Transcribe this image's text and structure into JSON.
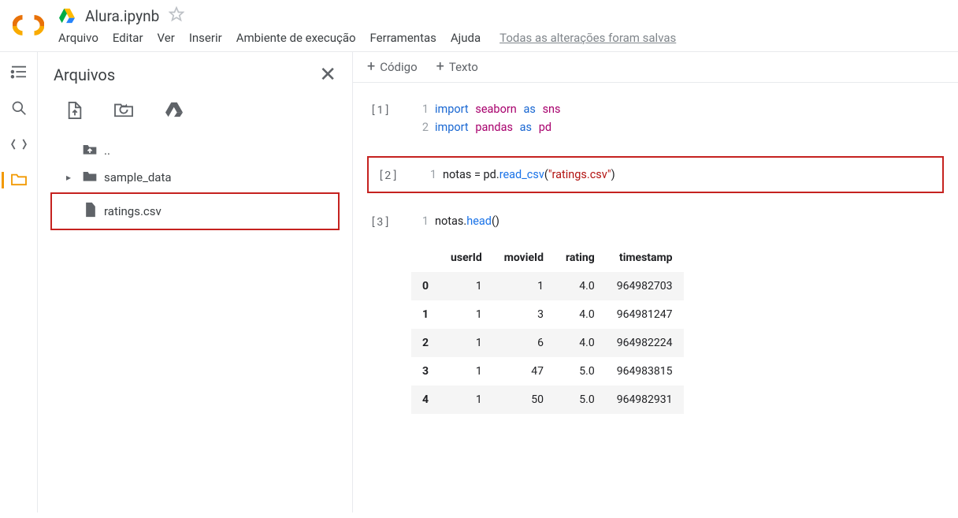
{
  "header": {
    "notebook_title": "Alura.ipynb",
    "menu": [
      "Arquivo",
      "Editar",
      "Ver",
      "Inserir",
      "Ambiente de execução",
      "Ferramentas",
      "Ajuda"
    ],
    "save_status": "Todas as alterações foram salvas"
  },
  "rail": {
    "toc_icon": "toc-icon",
    "search_icon": "search-icon",
    "vars_icon": "vars-icon",
    "folder_icon": "folder-icon"
  },
  "sidebar": {
    "title": "Arquivos",
    "tools": [
      "upload-icon",
      "refresh-icon",
      "mount-drive-icon"
    ],
    "tree": {
      "up": "..",
      "sample_data": "sample_data",
      "ratings": "ratings.csv"
    }
  },
  "content_toolbar": {
    "code": "Código",
    "text": "Texto"
  },
  "cells": {
    "c1_prompt": "[1]",
    "c1_line1_gutter": "1",
    "c1_line1_a": "import",
    "c1_line1_b": "seaborn",
    "c1_line1_c": "as",
    "c1_line1_d": "sns",
    "c1_line2_gutter": "2",
    "c1_line2_a": "import",
    "c1_line2_b": "pandas",
    "c1_line2_c": "as",
    "c1_line2_d": "pd",
    "c2_prompt": "[2]",
    "c2_line1_gutter": "1",
    "c2_line1_code_a": "notas = pd.",
    "c2_line1_code_b": "read_csv",
    "c2_line1_code_c": "(",
    "c2_line1_code_d": "\"ratings.csv\"",
    "c2_line1_code_e": ")",
    "c3_prompt": "[3]",
    "c3_line1_gutter": "1",
    "c3_line1_code_a": "notas.",
    "c3_line1_code_b": "head",
    "c3_line1_code_c": "()"
  },
  "chart_data": {
    "type": "table",
    "columns": [
      "",
      "userId",
      "movieId",
      "rating",
      "timestamp"
    ],
    "rows": [
      [
        "0",
        "1",
        "1",
        "4.0",
        "964982703"
      ],
      [
        "1",
        "1",
        "3",
        "4.0",
        "964981247"
      ],
      [
        "2",
        "1",
        "6",
        "4.0",
        "964982224"
      ],
      [
        "3",
        "1",
        "47",
        "5.0",
        "964983815"
      ],
      [
        "4",
        "1",
        "50",
        "5.0",
        "964982931"
      ]
    ]
  }
}
